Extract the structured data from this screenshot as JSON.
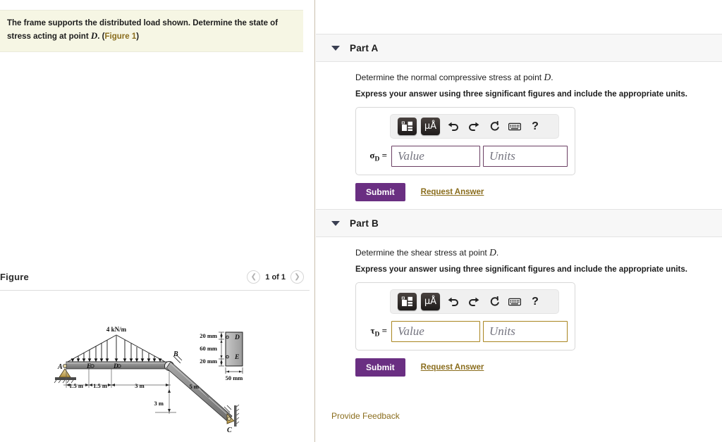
{
  "problem": {
    "statement_part1": "The frame supports the distributed load shown. Determine the state of stress acting at point ",
    "statement_symbol": "D",
    "statement_part2": ". (",
    "figure_link": "Figure 1",
    "statement_part3": ")"
  },
  "figure_panel": {
    "title": "Figure",
    "pagination": {
      "prev_icon": "chevron-left-icon",
      "count_label": "1 of 1",
      "next_icon": "chevron-right-icon"
    }
  },
  "diagram": {
    "load_label": "4 kN/m",
    "point_a": "A",
    "point_b": "B",
    "point_c": "C",
    "point_d": "D",
    "point_e": "E",
    "section_d": "D",
    "section_e": "E",
    "dim_1": "1.5 m",
    "dim_2": "1.5 m",
    "dim_3": "3 m",
    "dim_vertical": "3 m",
    "dim_diagonal": "5 m",
    "cs_top": "20 mm",
    "cs_mid": "60 mm",
    "cs_bot": "20 mm",
    "cs_width": "50 mm"
  },
  "parts": [
    {
      "id": "a",
      "caret_icon": "chevron-down-icon",
      "label": "Part A",
      "question": "Determine the normal compressive stress at point ",
      "question_symbol": "D",
      "question_end": ".",
      "instruction": "Express your answer using three significant figures and include the appropriate units.",
      "symbol_base": "σ",
      "symbol_sub": "D",
      "symbol_eq": " =",
      "toolbar": {
        "template_icon": "math-template-icon",
        "units_icon": "micro-angstrom-units-icon",
        "units_label": "μÅ",
        "undo_icon": "undo-icon",
        "redo_icon": "redo-icon",
        "reset_icon": "reset-icon",
        "keyboard_icon": "keyboard-icon",
        "help_icon": "help-icon",
        "help_label": "?"
      },
      "value_placeholder": "Value",
      "units_placeholder": "Units",
      "value": "",
      "units": "",
      "submit_label": "Submit",
      "request_answer_label": "Request Answer",
      "input_border_color": "#6b3f63"
    },
    {
      "id": "b",
      "caret_icon": "chevron-down-icon",
      "label": "Part B",
      "question": "Determine the shear stress at point ",
      "question_symbol": "D",
      "question_end": ".",
      "instruction": "Express your answer using three significant figures and include the appropriate units.",
      "symbol_base": "τ",
      "symbol_sub": "D",
      "symbol_eq": " =",
      "toolbar": {
        "template_icon": "math-template-icon",
        "units_icon": "micro-angstrom-units-icon",
        "units_label": "μÅ",
        "undo_icon": "undo-icon",
        "redo_icon": "redo-icon",
        "reset_icon": "reset-icon",
        "keyboard_icon": "keyboard-icon",
        "help_icon": "help-icon",
        "help_label": "?"
      },
      "value_placeholder": "Value",
      "units_placeholder": "Units",
      "value": "",
      "units": "",
      "submit_label": "Submit",
      "request_answer_label": "Request Answer",
      "input_border_color": "#a9851f"
    }
  ],
  "feedback": {
    "label": "Provide Feedback"
  },
  "colors": {
    "submit_purple": "#6a2f82",
    "link_gold": "#8a6d1d",
    "problem_bg": "#f6f6e4",
    "part_header_bg": "#f7f7f7"
  }
}
